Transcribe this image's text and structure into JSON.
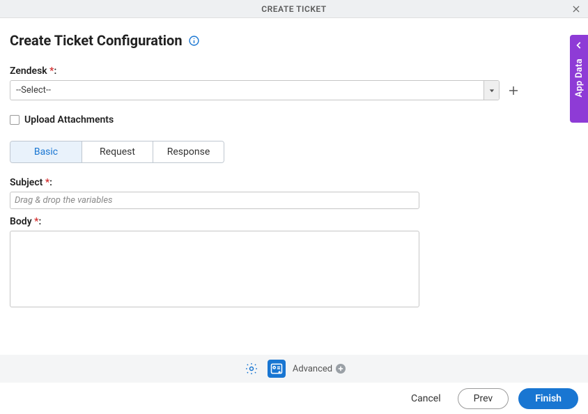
{
  "header": {
    "title": "CREATE TICKET"
  },
  "page": {
    "title": "Create Ticket Configuration"
  },
  "form": {
    "zendesk": {
      "label": "Zendesk",
      "selected": "--Select--"
    },
    "upload_attachments_label": "Upload Attachments",
    "tabs": [
      {
        "label": "Basic",
        "active": true
      },
      {
        "label": "Request",
        "active": false
      },
      {
        "label": "Response",
        "active": false
      }
    ],
    "subject": {
      "label": "Subject",
      "placeholder": "Drag & drop the variables",
      "value": ""
    },
    "body": {
      "label": "Body",
      "value": ""
    }
  },
  "bottom_toolbar": {
    "advanced_label": "Advanced"
  },
  "footer": {
    "cancel": "Cancel",
    "prev": "Prev",
    "finish": "Finish"
  },
  "side_panel": {
    "label": "App Data"
  }
}
